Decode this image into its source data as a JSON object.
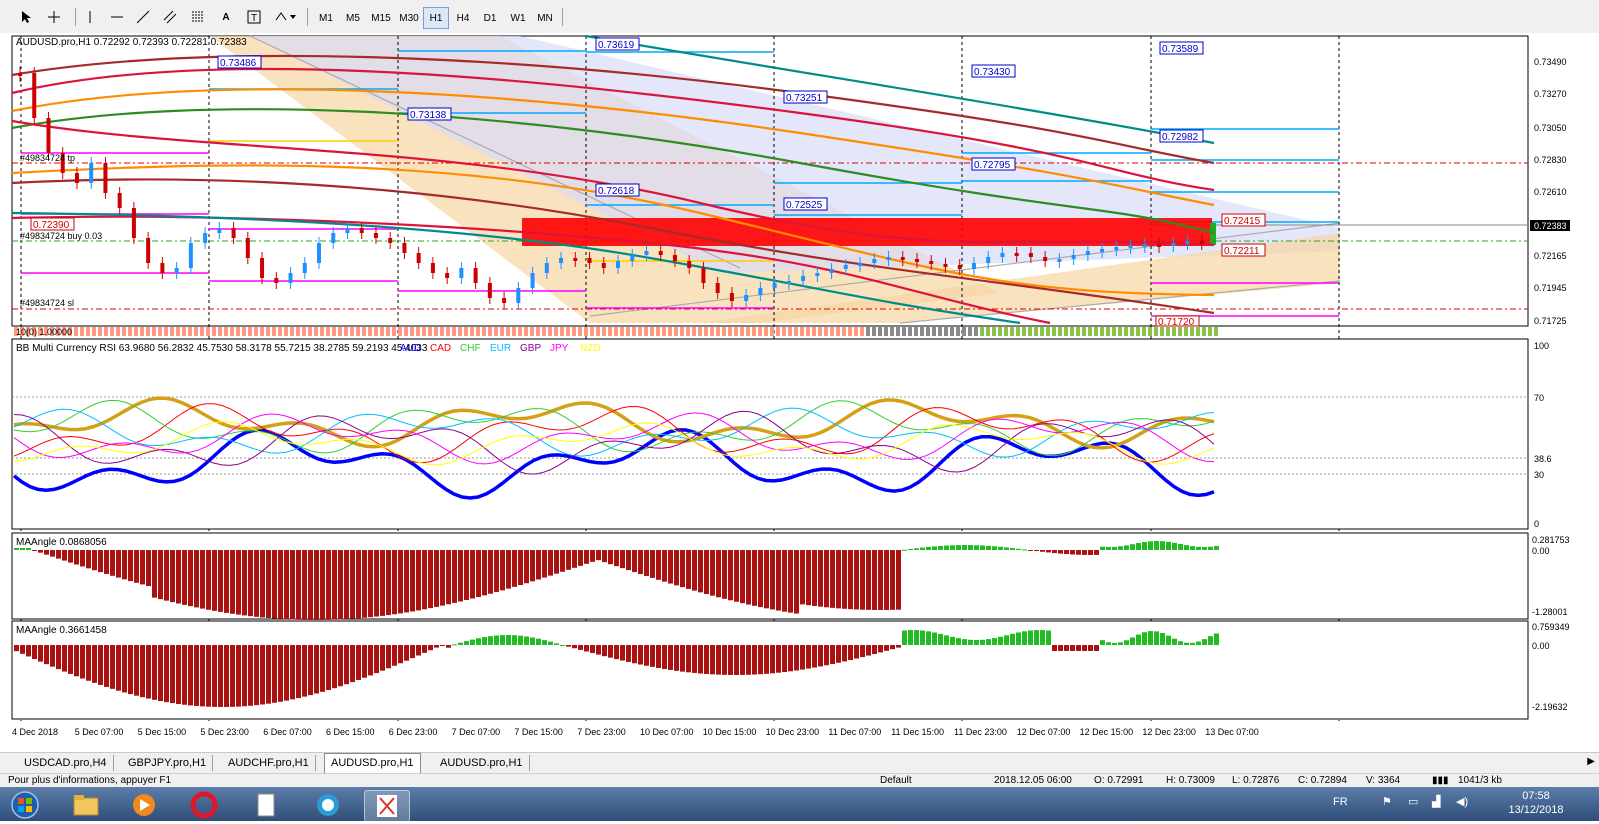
{
  "toolbar": {
    "timeframes": [
      "M1",
      "M5",
      "M15",
      "M30",
      "H1",
      "H4",
      "D1",
      "W1",
      "MN"
    ],
    "active_timeframe": "H1"
  },
  "chart": {
    "header": "AUDUSD.pro,H1  0.72292 0.72393 0.72281 0.72383",
    "symbol_short": "AUDUSD.pro,H1",
    "current_price": "0.72383",
    "price_axis": [
      "0.73490",
      "0.73270",
      "0.73050",
      "0.72830",
      "0.72610",
      "0.72383",
      "0.72165",
      "0.71945",
      "0.71725"
    ],
    "time_axis": [
      "4 Dec 2018",
      "5 Dec 07:00",
      "5 Dec 15:00",
      "5 Dec 23:00",
      "6 Dec 07:00",
      "6 Dec 15:00",
      "6 Dec 23:00",
      "7 Dec 07:00",
      "7 Dec 15:00",
      "7 Dec 23:00",
      "10 Dec 07:00",
      "10 Dec 15:00",
      "10 Dec 23:00",
      "11 Dec 07:00",
      "11 Dec 15:00",
      "11 Dec 23:00",
      "12 Dec 07:00",
      "12 Dec 15:00",
      "12 Dec 23:00",
      "13 Dec 07:00"
    ],
    "blue_labels": [
      "0.73486",
      "0.73619",
      "0.73138",
      "0.73251",
      "0.73430",
      "0.73589",
      "0.72982",
      "0.72795",
      "0.72618",
      "0.72525"
    ],
    "red_labels": [
      "0.72390",
      "0.72415",
      "0.72211",
      "0.71720"
    ],
    "order_tp": "#49834724 tp",
    "order_buy": "#49834724 buy 0.03",
    "order_sl": "#49834724 sl",
    "indicator_strip": "10(0) 1.00000",
    "colors": {
      "bull": "#1e90ff",
      "bear": "#cc0000",
      "zone": "#ff0000"
    }
  },
  "rsi": {
    "title": "BB Multi Currency RSI 63.9680 56.2832 45.7530 58.3178 55.7215 38.2785 59.2193 45.4033",
    "currencies": [
      {
        "name": "AUD",
        "color": "#0000ff"
      },
      {
        "name": "CAD",
        "color": "#ff0000"
      },
      {
        "name": "CHF",
        "color": "#32cd32"
      },
      {
        "name": "EUR",
        "color": "#00bfff"
      },
      {
        "name": "GBP",
        "color": "#8b008b"
      },
      {
        "name": "JPY",
        "color": "#ff00ff"
      },
      {
        "name": "NZD",
        "color": "#ffff00"
      },
      {
        "name": "USD",
        "color": "#ffffff"
      }
    ],
    "axis": [
      "100",
      "70",
      "38.6",
      "30",
      "0"
    ]
  },
  "ma1": {
    "title": "MAAngle 0.0868056",
    "axis": [
      "0.281753",
      "0.00",
      "-1.28001"
    ]
  },
  "ma2": {
    "title": "MAAngle 0.3661458",
    "axis": [
      "0.759349",
      "0.00",
      "-2.19632"
    ]
  },
  "tabs": [
    "USDCAD.pro,H4",
    "GBPJPY.pro,H1",
    "AUDCHF.pro,H1",
    "AUDUSD.pro,H1",
    "AUDUSD.pro,H1"
  ],
  "active_tab": 3,
  "status": {
    "help": "Pour plus d'informations, appuyer F1",
    "profile": "Default",
    "datetime": "2018.12.05 06:00",
    "open": "O: 0.72991",
    "high": "H: 0.73009",
    "low": "L: 0.72876",
    "close": "C: 0.72894",
    "volume": "V: 3364",
    "traffic": "1041/3 kb"
  },
  "taskbar": {
    "lang": "FR",
    "time": "07:58",
    "date": "13/12/2018"
  }
}
